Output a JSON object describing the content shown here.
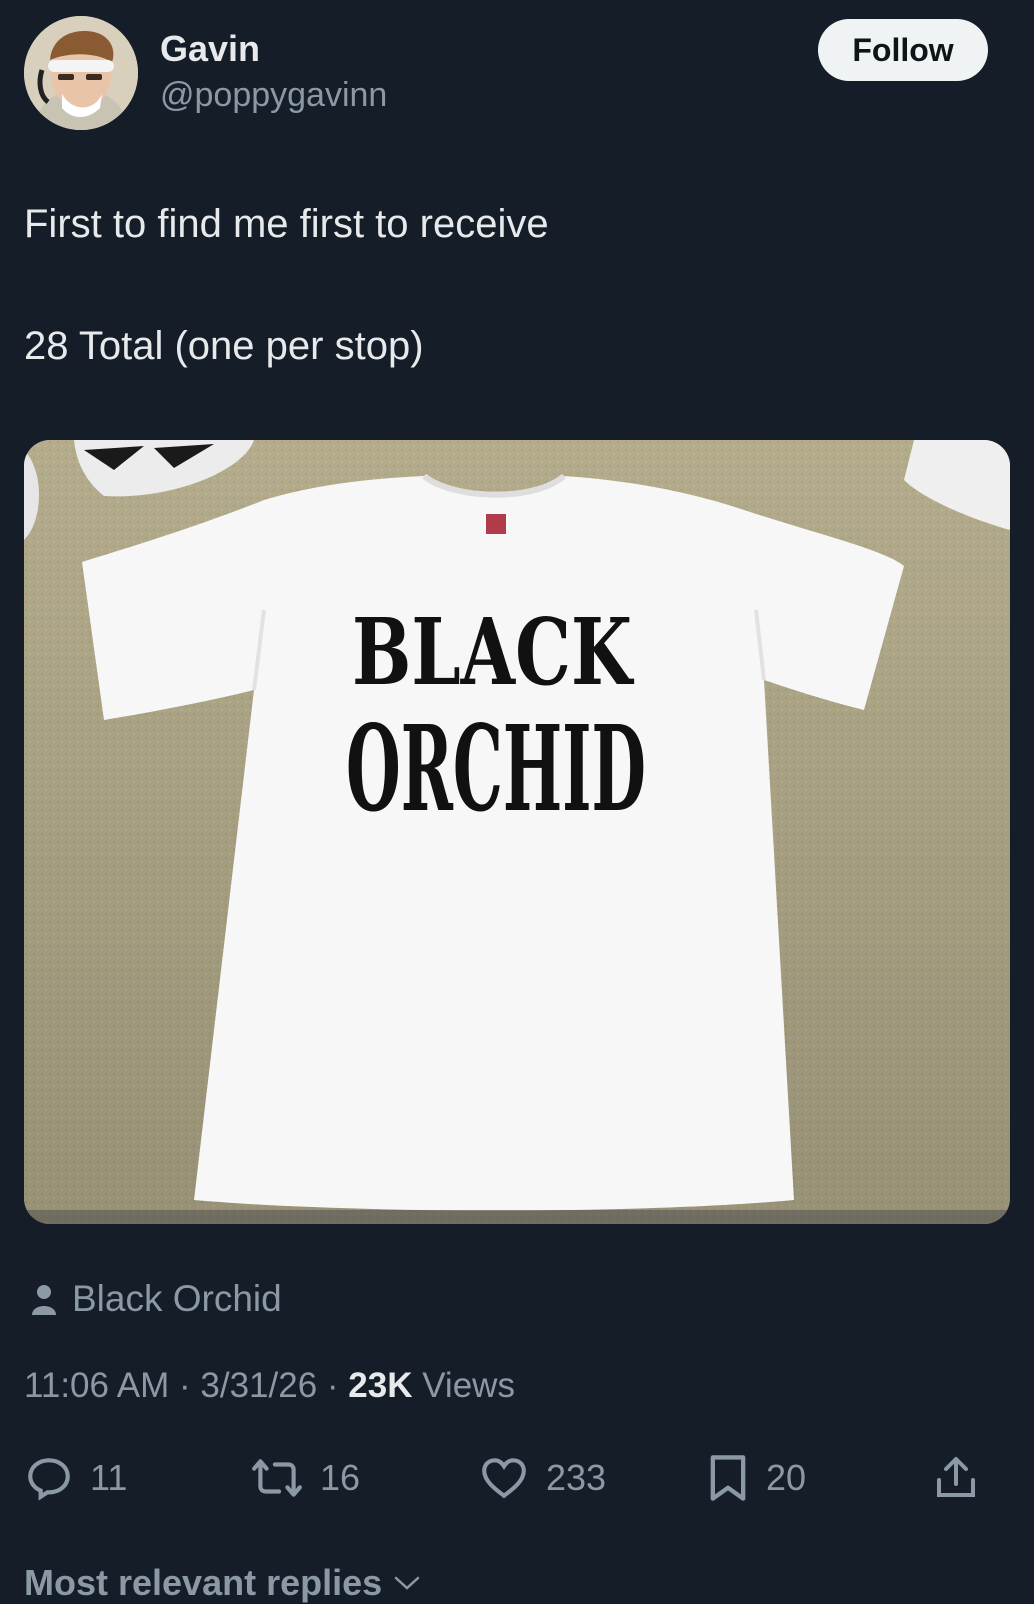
{
  "author": {
    "display_name": "Gavin",
    "handle": "@poppygavinn",
    "avatar_icon": "user-avatar"
  },
  "follow_label": "Follow",
  "tweet": {
    "lines": [
      "First to find me first to receive",
      "28 Total (one per stop)"
    ]
  },
  "media": {
    "shirt_print": [
      "BLACK",
      "ORCHID"
    ]
  },
  "tagged": {
    "icon": "person-icon",
    "name": "Black Orchid"
  },
  "meta": {
    "time": "11:06 AM",
    "sep1": " · ",
    "date": "3/31/26",
    "sep2": " · ",
    "views_count": "23K",
    "views_label": " Views"
  },
  "actions": {
    "reply": {
      "icon": "reply-icon",
      "count": "11"
    },
    "repost": {
      "icon": "repost-icon",
      "count": "16"
    },
    "like": {
      "icon": "heart-icon",
      "count": "233"
    },
    "bookmark": {
      "icon": "bookmark-icon",
      "count": "20"
    },
    "share": {
      "icon": "share-icon"
    }
  },
  "replies_heading": "Most relevant replies",
  "colors": {
    "background": "#151d29",
    "primary_text": "#e7e9ea",
    "secondary_text": "#8b98a5",
    "follow_bg": "#eff3f4"
  }
}
